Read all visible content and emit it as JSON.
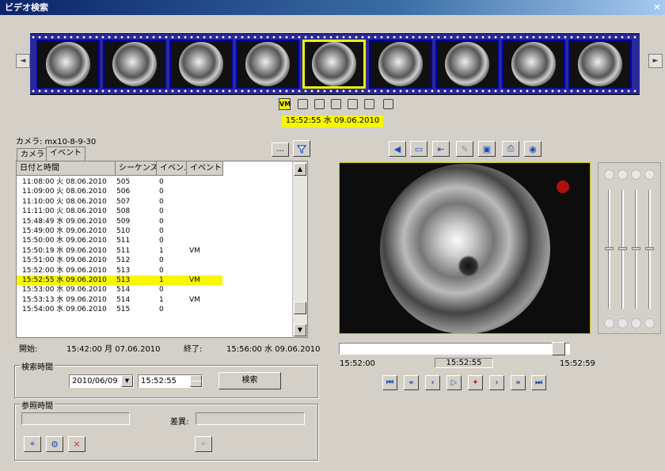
{
  "window": {
    "title": "ビデオ検索",
    "close_glyph": "×"
  },
  "filmstrip": {
    "left_arrow": "◄",
    "right_arrow": "►",
    "frame_count": 9,
    "selected_index": 4
  },
  "vm_indicator": {
    "label": "VM",
    "timestamp": "15:52:55 水 09.06.2010"
  },
  "camera": {
    "label": "カメラ: mx10-8-9-30",
    "browse_label": "..."
  },
  "tabs": [
    {
      "label": "カメラ"
    },
    {
      "label": "イベント"
    }
  ],
  "table": {
    "columns": [
      "日付と時間",
      "シーケンス",
      "イベン...",
      "イベント"
    ],
    "rows": [
      {
        "time": "11:08:00 火 08.06.2010",
        "seq": "505",
        "cnt": "0",
        "event": ""
      },
      {
        "time": "11:09:00 火 08.06.2010",
        "seq": "506",
        "cnt": "0",
        "event": ""
      },
      {
        "time": "11:10:00 火 08.06.2010",
        "seq": "507",
        "cnt": "0",
        "event": ""
      },
      {
        "time": "11:11:00 火 08.06.2010",
        "seq": "508",
        "cnt": "0",
        "event": ""
      },
      {
        "time": "15:48:49 水 09.06.2010",
        "seq": "509",
        "cnt": "0",
        "event": ""
      },
      {
        "time": "15:49:00 水 09.06.2010",
        "seq": "510",
        "cnt": "0",
        "event": ""
      },
      {
        "time": "15:50:00 水 09.06.2010",
        "seq": "511",
        "cnt": "0",
        "event": ""
      },
      {
        "time": "15:50:19 水 09.06.2010",
        "seq": "511",
        "cnt": "1",
        "event": "VM"
      },
      {
        "time": "15:51:00 水 09.06.2010",
        "seq": "512",
        "cnt": "0",
        "event": ""
      },
      {
        "time": "15:52:00 水 09.06.2010",
        "seq": "513",
        "cnt": "0",
        "event": ""
      },
      {
        "time": "15:52:55 水 09.06.2010",
        "seq": "513",
        "cnt": "1",
        "event": "VM"
      },
      {
        "time": "15:53:00 水 09.06.2010",
        "seq": "514",
        "cnt": "0",
        "event": ""
      },
      {
        "time": "15:53:13 水 09.06.2010",
        "seq": "514",
        "cnt": "1",
        "event": "VM"
      },
      {
        "time": "15:54:00 水 09.06.2010",
        "seq": "515",
        "cnt": "0",
        "event": ""
      }
    ],
    "selected_row": 10
  },
  "range": {
    "start_label": "開始:",
    "start_value": "15:42:00 月 07.06.2010",
    "end_label": "終了:",
    "end_value": "15:56:00 水 09.06.2010"
  },
  "search": {
    "group_title": "検索時間",
    "date": "2010/06/09",
    "time": "15:52:55",
    "button": "検索"
  },
  "reference": {
    "group_title": "参照時間",
    "diff_label": "差異:",
    "ref_value": "",
    "diff_value": ""
  },
  "timeline": {
    "left": "15:52:00",
    "current": "15:52:55",
    "right": "15:52:59",
    "position": 0.95
  },
  "playback": [
    "⏮",
    "«",
    "‹",
    "▷",
    "✦",
    "›",
    "»",
    "⏭"
  ],
  "colors": {
    "accent_yellow": "#f7f700",
    "film_blue": "#2a2a9a",
    "icon_blue": "#1b4fb8"
  }
}
